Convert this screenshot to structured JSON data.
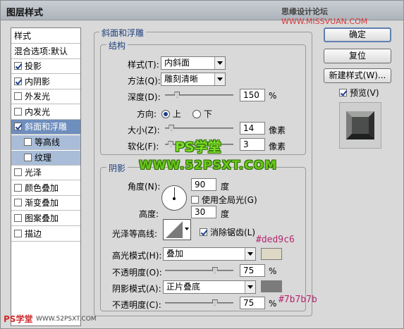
{
  "window": {
    "title": "图层样式",
    "watermark_prefix": "思缘设计论坛",
    "watermark_site": "WWW.MISSVUAN.COM"
  },
  "styles_list": {
    "header": "样式",
    "blend_default": "混合选项:默认",
    "items": [
      {
        "label": "投影",
        "checked": true
      },
      {
        "label": "内阴影",
        "checked": true
      },
      {
        "label": "外发光",
        "checked": false
      },
      {
        "label": "内发光",
        "checked": false
      },
      {
        "label": "斜面和浮雕",
        "checked": true
      },
      {
        "label": "等高线",
        "checked": false
      },
      {
        "label": "纹理",
        "checked": false
      },
      {
        "label": "光泽",
        "checked": false
      },
      {
        "label": "颜色叠加",
        "checked": false
      },
      {
        "label": "渐变叠加",
        "checked": false
      },
      {
        "label": "图案叠加",
        "checked": false
      },
      {
        "label": "描边",
        "checked": false
      }
    ]
  },
  "bevel": {
    "section_title": "斜面和浮雕",
    "structure": {
      "title": "结构",
      "style_label": "样式(T):",
      "style_value": "内斜面",
      "technique_label": "方法(Q):",
      "technique_value": "雕刻清晰",
      "depth_label": "深度(D):",
      "depth_value": "150",
      "depth_unit": "%",
      "depth_pct": 0.15,
      "direction_label": "方向:",
      "dir_up": "上",
      "dir_down": "下",
      "size_label": "大小(Z):",
      "size_value": "14",
      "size_unit": "像素",
      "size_pct": 0.06,
      "soften_label": "软化(F):",
      "soften_value": "3",
      "soften_unit": "像素",
      "soften_pct": 0.05
    },
    "shading": {
      "title": "阴影",
      "angle_label": "角度(N):",
      "angle_value": "90",
      "angle_unit": "度",
      "global_light_label": "使用全局光(G)",
      "altitude_label": "高度:",
      "altitude_value": "30",
      "altitude_unit": "度",
      "gloss_contour_label": "光泽等高线:",
      "anti_alias_label": "消除锯齿(L)",
      "highlight_mode_label": "高光模式(H):",
      "highlight_mode_value": "叠加",
      "highlight_color": "#ded9c6",
      "highlight_opacity_label": "不透明度(O):",
      "highlight_opacity_value": "75",
      "opacity_unit": "%",
      "highlight_opacity_pct": 0.75,
      "shadow_mode_label": "阴影模式(A):",
      "shadow_mode_value": "正片叠底",
      "shadow_color": "#7b7b7b",
      "shadow_opacity_label": "不透明度(C):",
      "shadow_opacity_value": "75",
      "shadow_opacity_pct": 0.75
    }
  },
  "buttons": {
    "ok": "确定",
    "reset": "复位",
    "new_style": "新建样式(W)...",
    "preview": "预览(V)"
  },
  "overlays": {
    "ps_label": "PS学堂",
    "ps_site": "WWW.52PSXT.COM",
    "hex_highlight": "#ded9c6",
    "hex_shadow": "#7b7b7b",
    "bottom_ps": "PS学堂",
    "bottom_site": "WWW.52PSXT.COM"
  }
}
